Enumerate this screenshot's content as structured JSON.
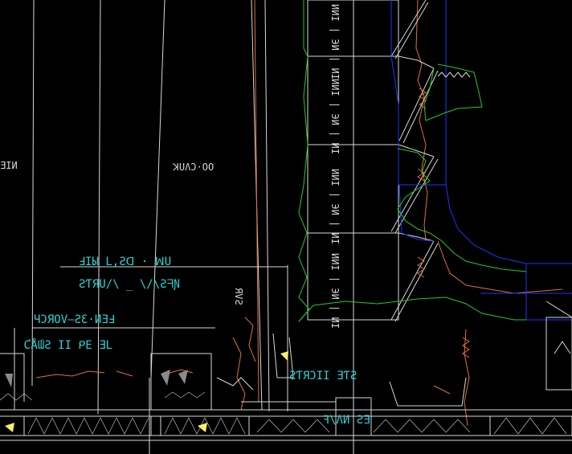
{
  "colors": {
    "background": "#000000",
    "linework": "#d8d8d8",
    "green_outline": "#22cc22",
    "blue_outline": "#2233ff",
    "orange_markup": "#e0703a",
    "cyan_labels": "#2ad4d4",
    "marker_fill": "#ffee66"
  },
  "icons": {
    "marker": "yellow-marker-icon",
    "arrowhead": "gray-arrowhead-icon"
  },
  "labels": {
    "cyan_1": "ℲIЫ L,Ƨᗡ · ꟽU",
    "cyan_2": "ƧƬЯU/\\ _ \\/\\ƧᖷƝ",
    "cyan_3": "ЧƆЯOV–ƧƐ·ИƎℲ",
    "cyan_4": "ƇǺƜƧ II ᑭE ƎL",
    "cyan_5": "ƧƬЯƆII ƎƬƧ",
    "cyan_6": "ꟻ\\ΛИ ƧƎ",
    "white_1": "ꓘUɅƆ·OO",
    "white_2": "ƎIИ",
    "white_3": "ИИI | ЭИ | ИI",
    "white_4": "ИИI | ЭИ | ИI",
    "white_5": "ИИI | ЭИ | ИI",
    "white_6": "ИИI | ЭИ | ИI",
    "white_7": "ЯVƧ"
  }
}
